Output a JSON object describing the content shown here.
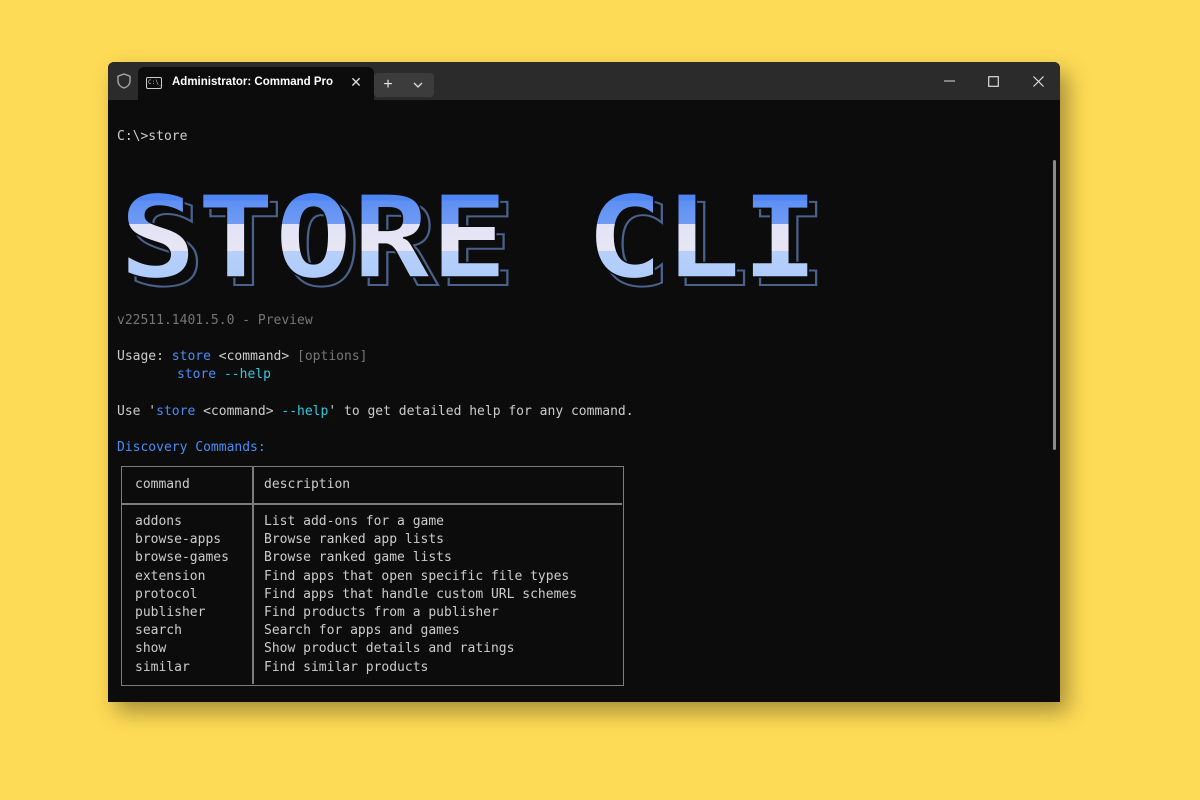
{
  "titlebar": {
    "tab_title": "Administrator: Command Pro",
    "tab_icon_text": "C:\\_",
    "close_tab_label": "✕",
    "new_tab_label": "+",
    "colors": {
      "titlebar": "#2b2b2b",
      "terminal_bg": "#0c0c0c"
    }
  },
  "terminal": {
    "prompt_line": "C:\\>store",
    "logo_text": "STORE CLI",
    "version": "v22511.1401.5.0 - Preview",
    "usage_label": "Usage: ",
    "usage_cmd": "store",
    "usage_args": " <command> ",
    "usage_options": "[options]",
    "usage2_cmd": "store",
    "usage2_flag": "--help",
    "hint_prefix": "Use '",
    "hint_cmd": "store",
    "hint_args": " <command> ",
    "hint_flag": "--help",
    "hint_suffix": "' to get detailed help for any command.",
    "section_title": "Discovery Commands:",
    "colors": {
      "blue": "#4a8cf2",
      "cyan": "#37c8dc",
      "grey": "#767676",
      "text": "#cccccc"
    }
  },
  "table": {
    "headers": [
      "command",
      "description"
    ],
    "rows": [
      {
        "command": "addons",
        "description": "List add-ons for a game"
      },
      {
        "command": "browse-apps",
        "description": "Browse ranked app lists"
      },
      {
        "command": "browse-games",
        "description": "Browse ranked game lists"
      },
      {
        "command": "extension",
        "description": "Find apps that open specific file types"
      },
      {
        "command": "protocol",
        "description": "Find apps that handle custom URL schemes"
      },
      {
        "command": "publisher",
        "description": "Find products from a publisher"
      },
      {
        "command": "search",
        "description": "Search for apps and games"
      },
      {
        "command": "show",
        "description": "Show product details and ratings"
      },
      {
        "command": "similar",
        "description": "Find similar products"
      }
    ]
  }
}
